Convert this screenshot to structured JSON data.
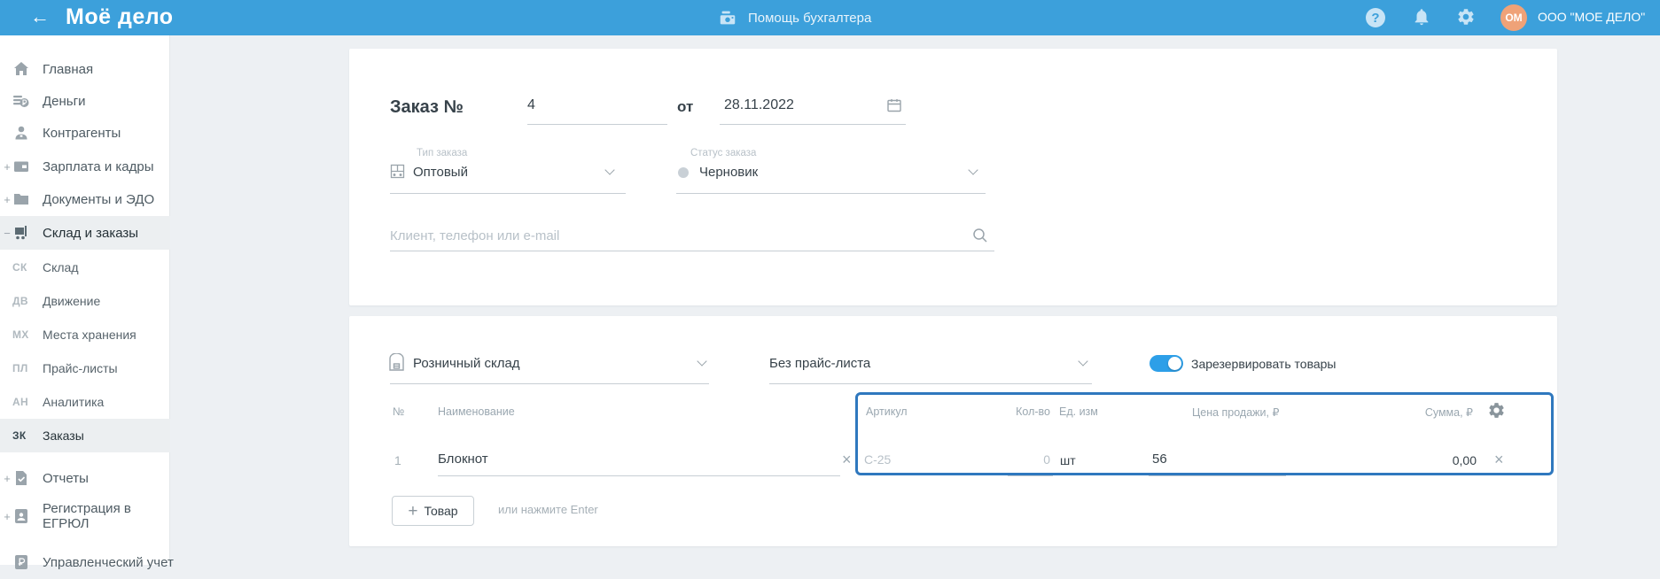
{
  "header": {
    "back_arrow": "←",
    "logo": "Моё дело",
    "help_center": "Помощь бухгалтера",
    "question_mark": "?",
    "avatar_initials": "ОМ",
    "company": "ООО \"МОЕ ДЕЛО\""
  },
  "sidebar": {
    "items": [
      {
        "label": "Главная",
        "expander": ""
      },
      {
        "label": "Деньги",
        "expander": ""
      },
      {
        "label": "Контрагенты",
        "expander": ""
      },
      {
        "label": "Зарплата и кадры",
        "expander": "+"
      },
      {
        "label": "Документы и ЭДО",
        "expander": "+"
      },
      {
        "label": "Склад и заказы",
        "expander": "−"
      }
    ],
    "subitems": [
      {
        "code": "СК",
        "label": "Склад"
      },
      {
        "code": "ДВ",
        "label": "Движение"
      },
      {
        "code": "МХ",
        "label": "Места хранения"
      },
      {
        "code": "ПЛ",
        "label": "Прайс-листы"
      },
      {
        "code": "АН",
        "label": "Аналитика"
      },
      {
        "code": "ЗК",
        "label": "Заказы"
      }
    ],
    "bottom_items": [
      {
        "label": "Отчеты",
        "expander": "+"
      },
      {
        "label": "Регистрация в ЕГРЮЛ",
        "expander": "+"
      },
      {
        "label": "Управленческий учет",
        "expander": ""
      }
    ]
  },
  "order": {
    "title_label": "Заказ №",
    "number": "4",
    "from_label": "от",
    "date": "28.11.2022",
    "type_label": "Тип заказа",
    "type_value": "Оптовый",
    "status_label": "Статус заказа",
    "status_value": "Черновик",
    "client_placeholder": "Клиент, телефон или e-mail"
  },
  "items_panel": {
    "warehouse_value": "Розничный склад",
    "pricelist_value": "Без прайс-листа",
    "reserve_label": "Зарезервировать товары",
    "reserve_on": true,
    "table": {
      "col_num": "№",
      "col_name": "Наименование",
      "col_article": "Артикул",
      "col_qty": "Кол-во",
      "col_unit": "Ед. изм",
      "col_price": "Цена продажи, ₽",
      "col_sum": "Сумма, ₽",
      "rows": [
        {
          "num": "1",
          "name": "Блокнот",
          "article_placeholder": "C-25",
          "qty_placeholder": "0",
          "unit": "шт",
          "price": "56",
          "sum": "0,00"
        }
      ]
    },
    "add_button_label": "Товар",
    "add_hint": "или нажмите Enter"
  },
  "colors": {
    "header_bg": "#3CA0DB",
    "accent_blue": "#2D9FE8",
    "focus_border": "#2F78BE",
    "avatar_bg": "#EFA278"
  }
}
